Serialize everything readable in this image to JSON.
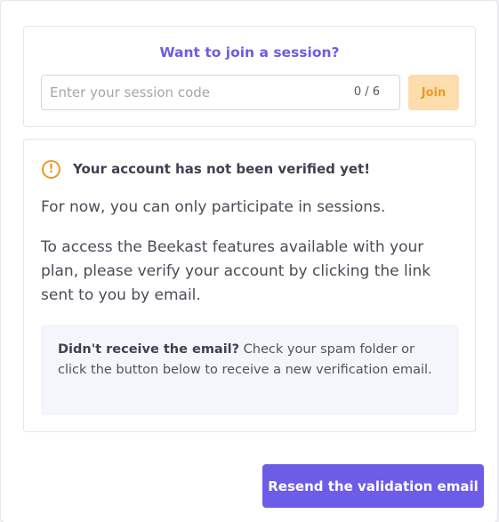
{
  "colors": {
    "accent": "#6c5ce7",
    "warning": "#e59a2c",
    "join_button_bg": "#fddcad",
    "info_box_bg": "#f5f6fb"
  },
  "join": {
    "title": "Want to join a session?",
    "code_input": {
      "value": "",
      "placeholder": "Enter your session code"
    },
    "counter": "0 / 6",
    "join_label": "Join"
  },
  "verification": {
    "warning_icon": "exclamation-circle-icon",
    "warning_glyph": "!",
    "title": "Your account has not been verified yet!",
    "paragraph_1": "For now, you can only participate in sessions.",
    "paragraph_2": "To access the Beekast features available with your plan, please verify your account by clicking the link sent to you by email.",
    "info_bold": "Didn't receive the email?",
    "info_text": " Check your spam folder or click the button below to receive a new verification email."
  },
  "footer": {
    "resend_label": "Resend the validation email"
  }
}
